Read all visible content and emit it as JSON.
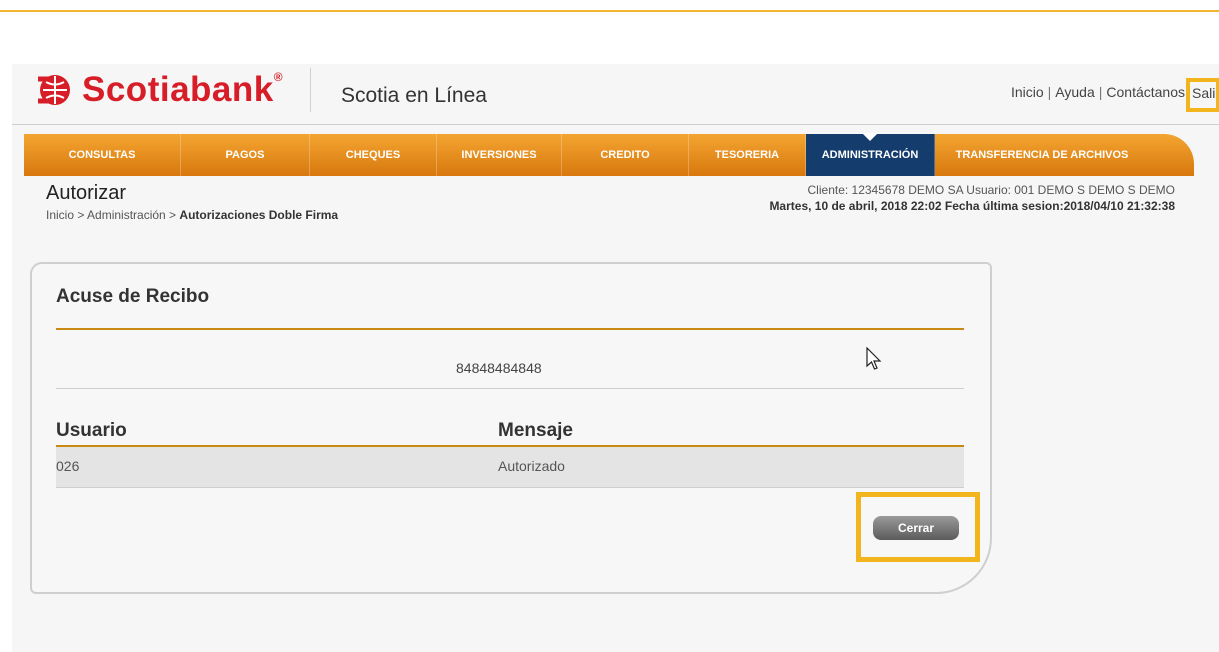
{
  "brand": {
    "logo_text": "Scotiabank",
    "logo_reg": "®",
    "product": "Scotia en Línea",
    "accent": "#d71e28",
    "nav_color": "#f3a531",
    "active_color": "#143c6d",
    "highlight": "#f3b51d"
  },
  "toplinks": {
    "home": "Inicio",
    "help": "Ayuda",
    "contact": "Contáctanos",
    "logout": "Sali",
    "separator": "|"
  },
  "nav": {
    "items": [
      {
        "label": "CONSULTAS"
      },
      {
        "label": "PAGOS"
      },
      {
        "label": "CHEQUES"
      },
      {
        "label": "INVERSIONES"
      },
      {
        "label": "CREDITO"
      },
      {
        "label": "TESORERIA"
      },
      {
        "label": "ADMINISTRACIÓN",
        "active": true
      },
      {
        "label": "TRANSFERENCIA DE ARCHIVOS"
      }
    ]
  },
  "page": {
    "title": "Autorizar",
    "breadcrumb_start": "Inicio > Administración > ",
    "breadcrumb_current": "Autorizaciones Doble Firma"
  },
  "client": {
    "line1": "Cliente: 12345678  DEMO SA     Usuario: 001 DEMO S DEMO S DEMO",
    "line2": "Martes, 10 de abril, 2018 22:02     Fecha última sesion:2018/04/10 21:32:38"
  },
  "receipt": {
    "title": "Acuse de Recibo",
    "reference": "84848484848",
    "columns": {
      "user": "Usuario",
      "message": "Mensaje"
    },
    "rows": [
      {
        "user": "026",
        "message": "Autorizado"
      }
    ],
    "close_label": "Cerrar"
  }
}
